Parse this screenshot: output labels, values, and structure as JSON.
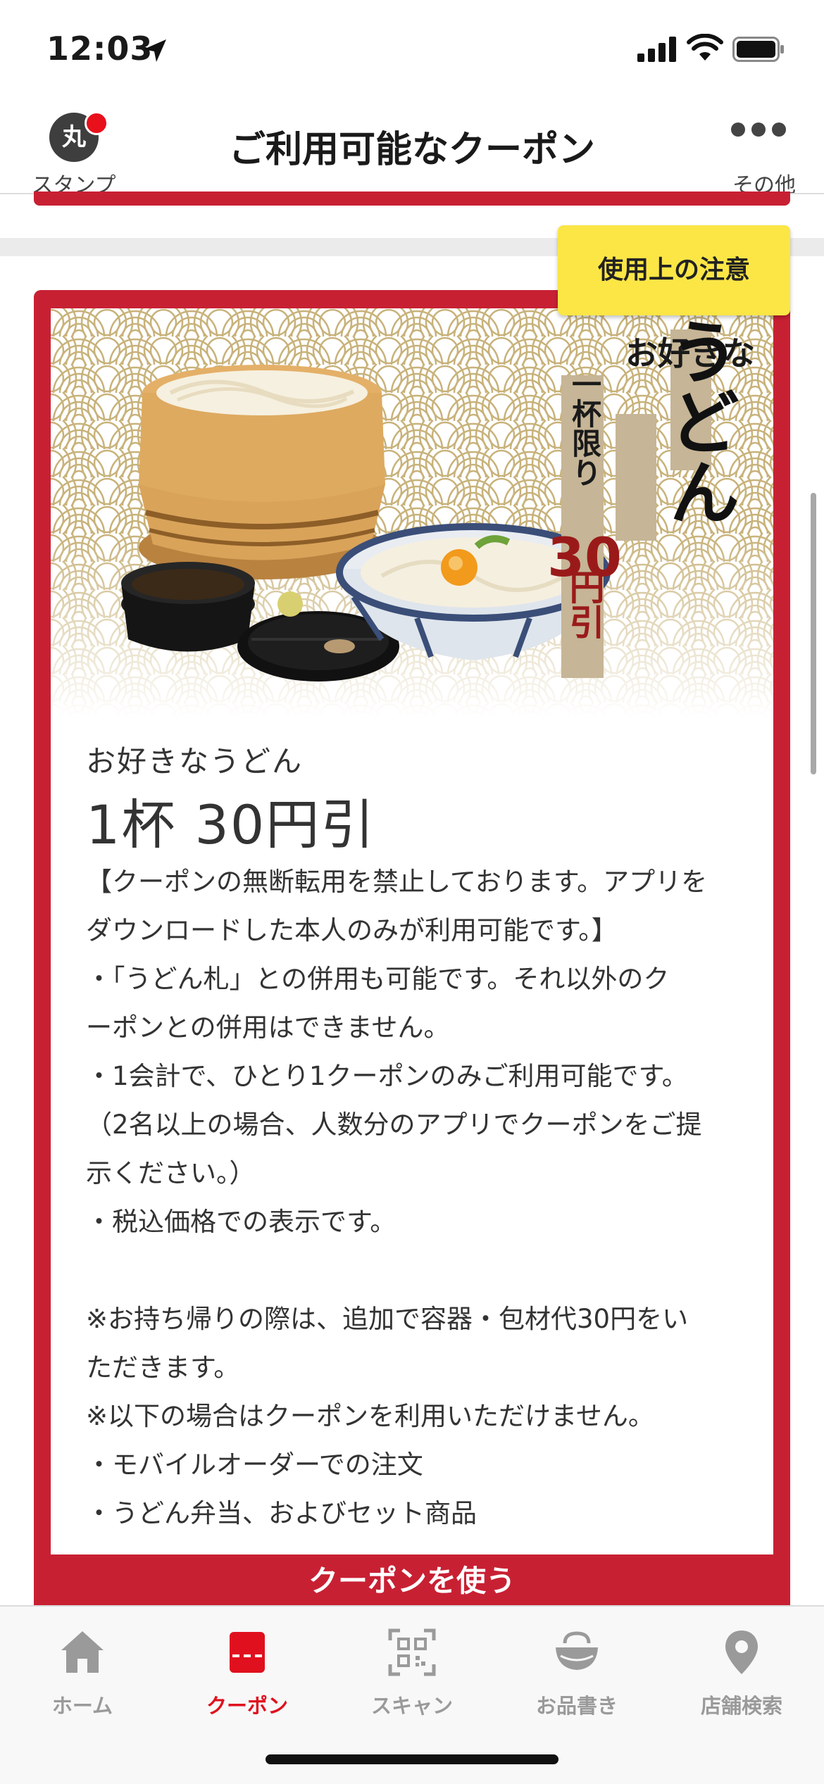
{
  "status": {
    "time": "12:03"
  },
  "header": {
    "stamp_icon_text": "丸",
    "stamp_label": "スタンプ",
    "title": "ご利用可能なクーポン",
    "more_label": "その他"
  },
  "coupon": {
    "notice_button": "使用上の注意",
    "banner": {
      "title_small": "お好きな",
      "title_large": "うどん",
      "limit_text": "一杯限り",
      "amount": "30",
      "unit": "円引"
    },
    "name": "お好きなうどん",
    "discount": "1杯 30円引",
    "description_lines": [
      "【クーポンの無断転用を禁止しております。アプリを",
      "ダウンロードした本人のみが利用可能です。】",
      "・「うどん札」との併用も可能です。それ以外のク",
      "ーポンとの併用はできません。",
      "・1会計で、ひとり1クーポンのみご利用可能です。",
      "（2名以上の場合、人数分のアプリでクーポンをご提",
      "示ください。）",
      "・税込価格での表示です。",
      "",
      "※お持ち帰りの際は、追加で容器・包材代30円をい",
      "ただきます。",
      "※以下の場合はクーポンを利用いただけません。",
      "・モバイルオーダーでの注文",
      "・うどん弁当、およびセット商品"
    ],
    "use_button": "クーポンを使う"
  },
  "tabs": [
    {
      "label": "ホーム",
      "icon": "home-icon",
      "active": false
    },
    {
      "label": "クーポン",
      "icon": "coupon-icon",
      "active": true
    },
    {
      "label": "スキャン",
      "icon": "qr-scan-icon",
      "active": false
    },
    {
      "label": "お品書き",
      "icon": "menu-bowl-icon",
      "active": false
    },
    {
      "label": "店舗検索",
      "icon": "location-pin-icon",
      "active": false
    }
  ],
  "colors": {
    "brand_red": "#c82033",
    "active_tab": "#e0101e",
    "notice_yellow": "#fbe646"
  }
}
